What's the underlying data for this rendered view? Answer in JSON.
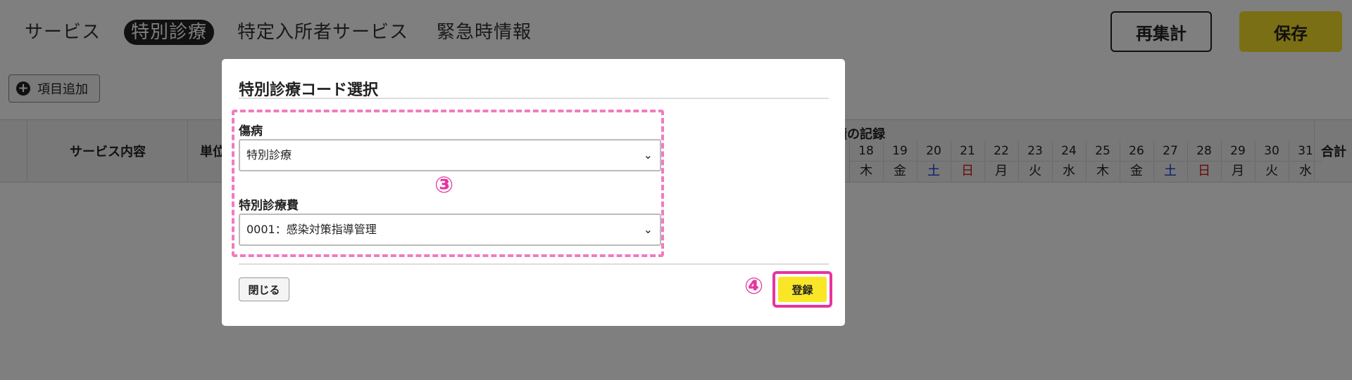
{
  "header": {
    "tabs": [
      {
        "label": "サービス",
        "active": false
      },
      {
        "label": "特別診療",
        "active": true
      },
      {
        "label": "特定入所者サービス",
        "active": false
      },
      {
        "label": "緊急時情報",
        "active": false
      }
    ],
    "recount_label": "再集計",
    "save_label": "保存"
  },
  "toolbar": {
    "add_item_label": "項目追加",
    "add_icon": "plus-circle-icon"
  },
  "table": {
    "col_service": "サービス内容",
    "col_unit": "単位",
    "record_label": "績の記録",
    "total_label": "合計",
    "days": [
      {
        "num": "18",
        "dow": "木"
      },
      {
        "num": "19",
        "dow": "金"
      },
      {
        "num": "20",
        "dow": "土"
      },
      {
        "num": "21",
        "dow": "日"
      },
      {
        "num": "22",
        "dow": "月"
      },
      {
        "num": "23",
        "dow": "火"
      },
      {
        "num": "24",
        "dow": "水"
      },
      {
        "num": "25",
        "dow": "木"
      },
      {
        "num": "26",
        "dow": "金"
      },
      {
        "num": "27",
        "dow": "土"
      },
      {
        "num": "28",
        "dow": "日"
      },
      {
        "num": "29",
        "dow": "月"
      },
      {
        "num": "30",
        "dow": "火"
      },
      {
        "num": "31",
        "dow": "水"
      }
    ]
  },
  "modal": {
    "title": "特別診療コード選択",
    "field1_label": "傷病",
    "field1_value": "特別診療",
    "field2_label": "特別診療費",
    "field2_value": "0001：感染対策指導管理",
    "step3": "③",
    "step4": "④",
    "close_label": "閉じる",
    "register_label": "登録"
  },
  "colors": {
    "save": "#f7df2b",
    "register": "#f8e627",
    "annotation": "#e8339f",
    "dashed_box": "#f07cc0",
    "saturday": "#1a3bd6",
    "sunday": "#d51414"
  }
}
